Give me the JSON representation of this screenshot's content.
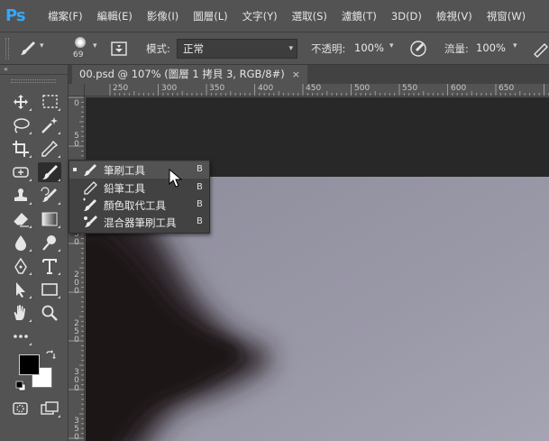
{
  "app": {
    "logo": "Ps"
  },
  "menu": [
    "檔案(F)",
    "編輯(E)",
    "影像(I)",
    "圖層(L)",
    "文字(Y)",
    "選取(S)",
    "濾鏡(T)",
    "3D(D)",
    "檢視(V)",
    "視窗(W)"
  ],
  "options": {
    "brush_size": "69",
    "mode_label": "模式:",
    "mode_value": "正常",
    "opacity_label": "不透明:",
    "opacity_value": "100%",
    "flow_label": "流量:",
    "flow_value": "100%"
  },
  "document": {
    "tab_title": "00.psd @ 107% (圖層 1 拷貝 3, RGB/8#)",
    "close_glyph": "×"
  },
  "ruler": {
    "top_labels": [
      "250",
      "300",
      "350",
      "400",
      "450",
      "500",
      "550",
      "600",
      "650"
    ],
    "left_labels": [
      "0",
      "5",
      "0",
      "1",
      "0",
      "1",
      "5",
      "0",
      "2",
      "0",
      "0",
      "2",
      "5",
      "0",
      "3",
      "0",
      "0",
      "3",
      "5",
      "0"
    ]
  },
  "tools": [
    {
      "name": "move-tool-icon"
    },
    {
      "name": "marquee-tool-icon"
    },
    {
      "name": "lasso-tool-icon"
    },
    {
      "name": "magic-wand-tool-icon"
    },
    {
      "name": "crop-tool-icon"
    },
    {
      "name": "eyedropper-tool-icon"
    },
    {
      "name": "healing-brush-tool-icon"
    },
    {
      "name": "brush-tool-icon"
    },
    {
      "name": "clone-stamp-tool-icon"
    },
    {
      "name": "history-brush-tool-icon"
    },
    {
      "name": "eraser-tool-icon"
    },
    {
      "name": "gradient-tool-icon"
    },
    {
      "name": "blur-tool-icon"
    },
    {
      "name": "dodge-tool-icon"
    },
    {
      "name": "pen-tool-icon"
    },
    {
      "name": "type-tool-icon"
    },
    {
      "name": "path-selection-tool-icon"
    },
    {
      "name": "rectangle-tool-icon"
    },
    {
      "name": "hand-tool-icon"
    },
    {
      "name": "zoom-tool-icon"
    },
    {
      "name": "more-tools-icon"
    }
  ],
  "flyout": [
    {
      "label": "筆刷工具",
      "key": "B",
      "selected": true
    },
    {
      "label": "鉛筆工具",
      "key": "B",
      "selected": false
    },
    {
      "label": "顏色取代工具",
      "key": "B",
      "selected": false
    },
    {
      "label": "混合器筆刷工具",
      "key": "B",
      "selected": false
    }
  ],
  "colors": {
    "foreground": "#000000",
    "background": "#ffffff",
    "accent": "#31a8ff"
  }
}
